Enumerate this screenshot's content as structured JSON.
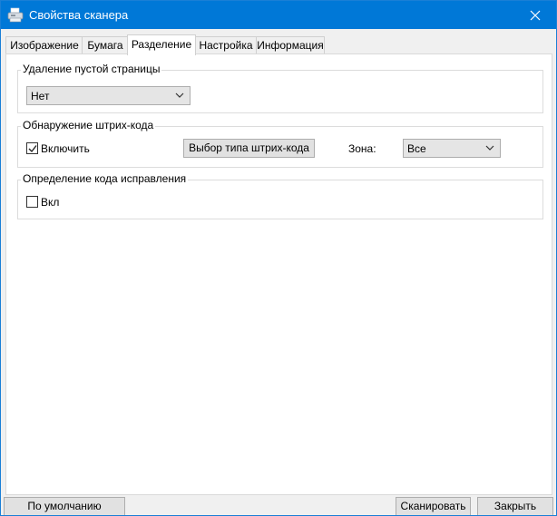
{
  "window": {
    "title": "Свойства сканера",
    "app_icon": "scanner-icon",
    "close_icon": "close-icon"
  },
  "tabs": [
    {
      "label": "Изображение",
      "active": false
    },
    {
      "label": "Бумага",
      "active": false
    },
    {
      "label": "Разделение",
      "active": true
    },
    {
      "label": "Настройка",
      "active": false
    },
    {
      "label": "Информация",
      "active": false
    }
  ],
  "blank_page": {
    "title": "Удаление пустой страницы",
    "select_value": "Нет"
  },
  "barcode": {
    "title": "Обнаружение штрих-кода",
    "enable_label": "Включить",
    "enable_checked": true,
    "type_button": "Выбор типа штрих-кода",
    "zone_label": "Зона:",
    "zone_value": "Все"
  },
  "patch_code": {
    "title": "Определение кода исправления",
    "on_label": "Вкл",
    "on_checked": false
  },
  "footer": {
    "defaults_button": "По умолчанию",
    "scan_button": "Сканировать",
    "close_button": "Закрыть"
  },
  "colors": {
    "titlebar": "#0078d7",
    "panel": "#ffffff",
    "window_bg": "#f0f0f0"
  }
}
